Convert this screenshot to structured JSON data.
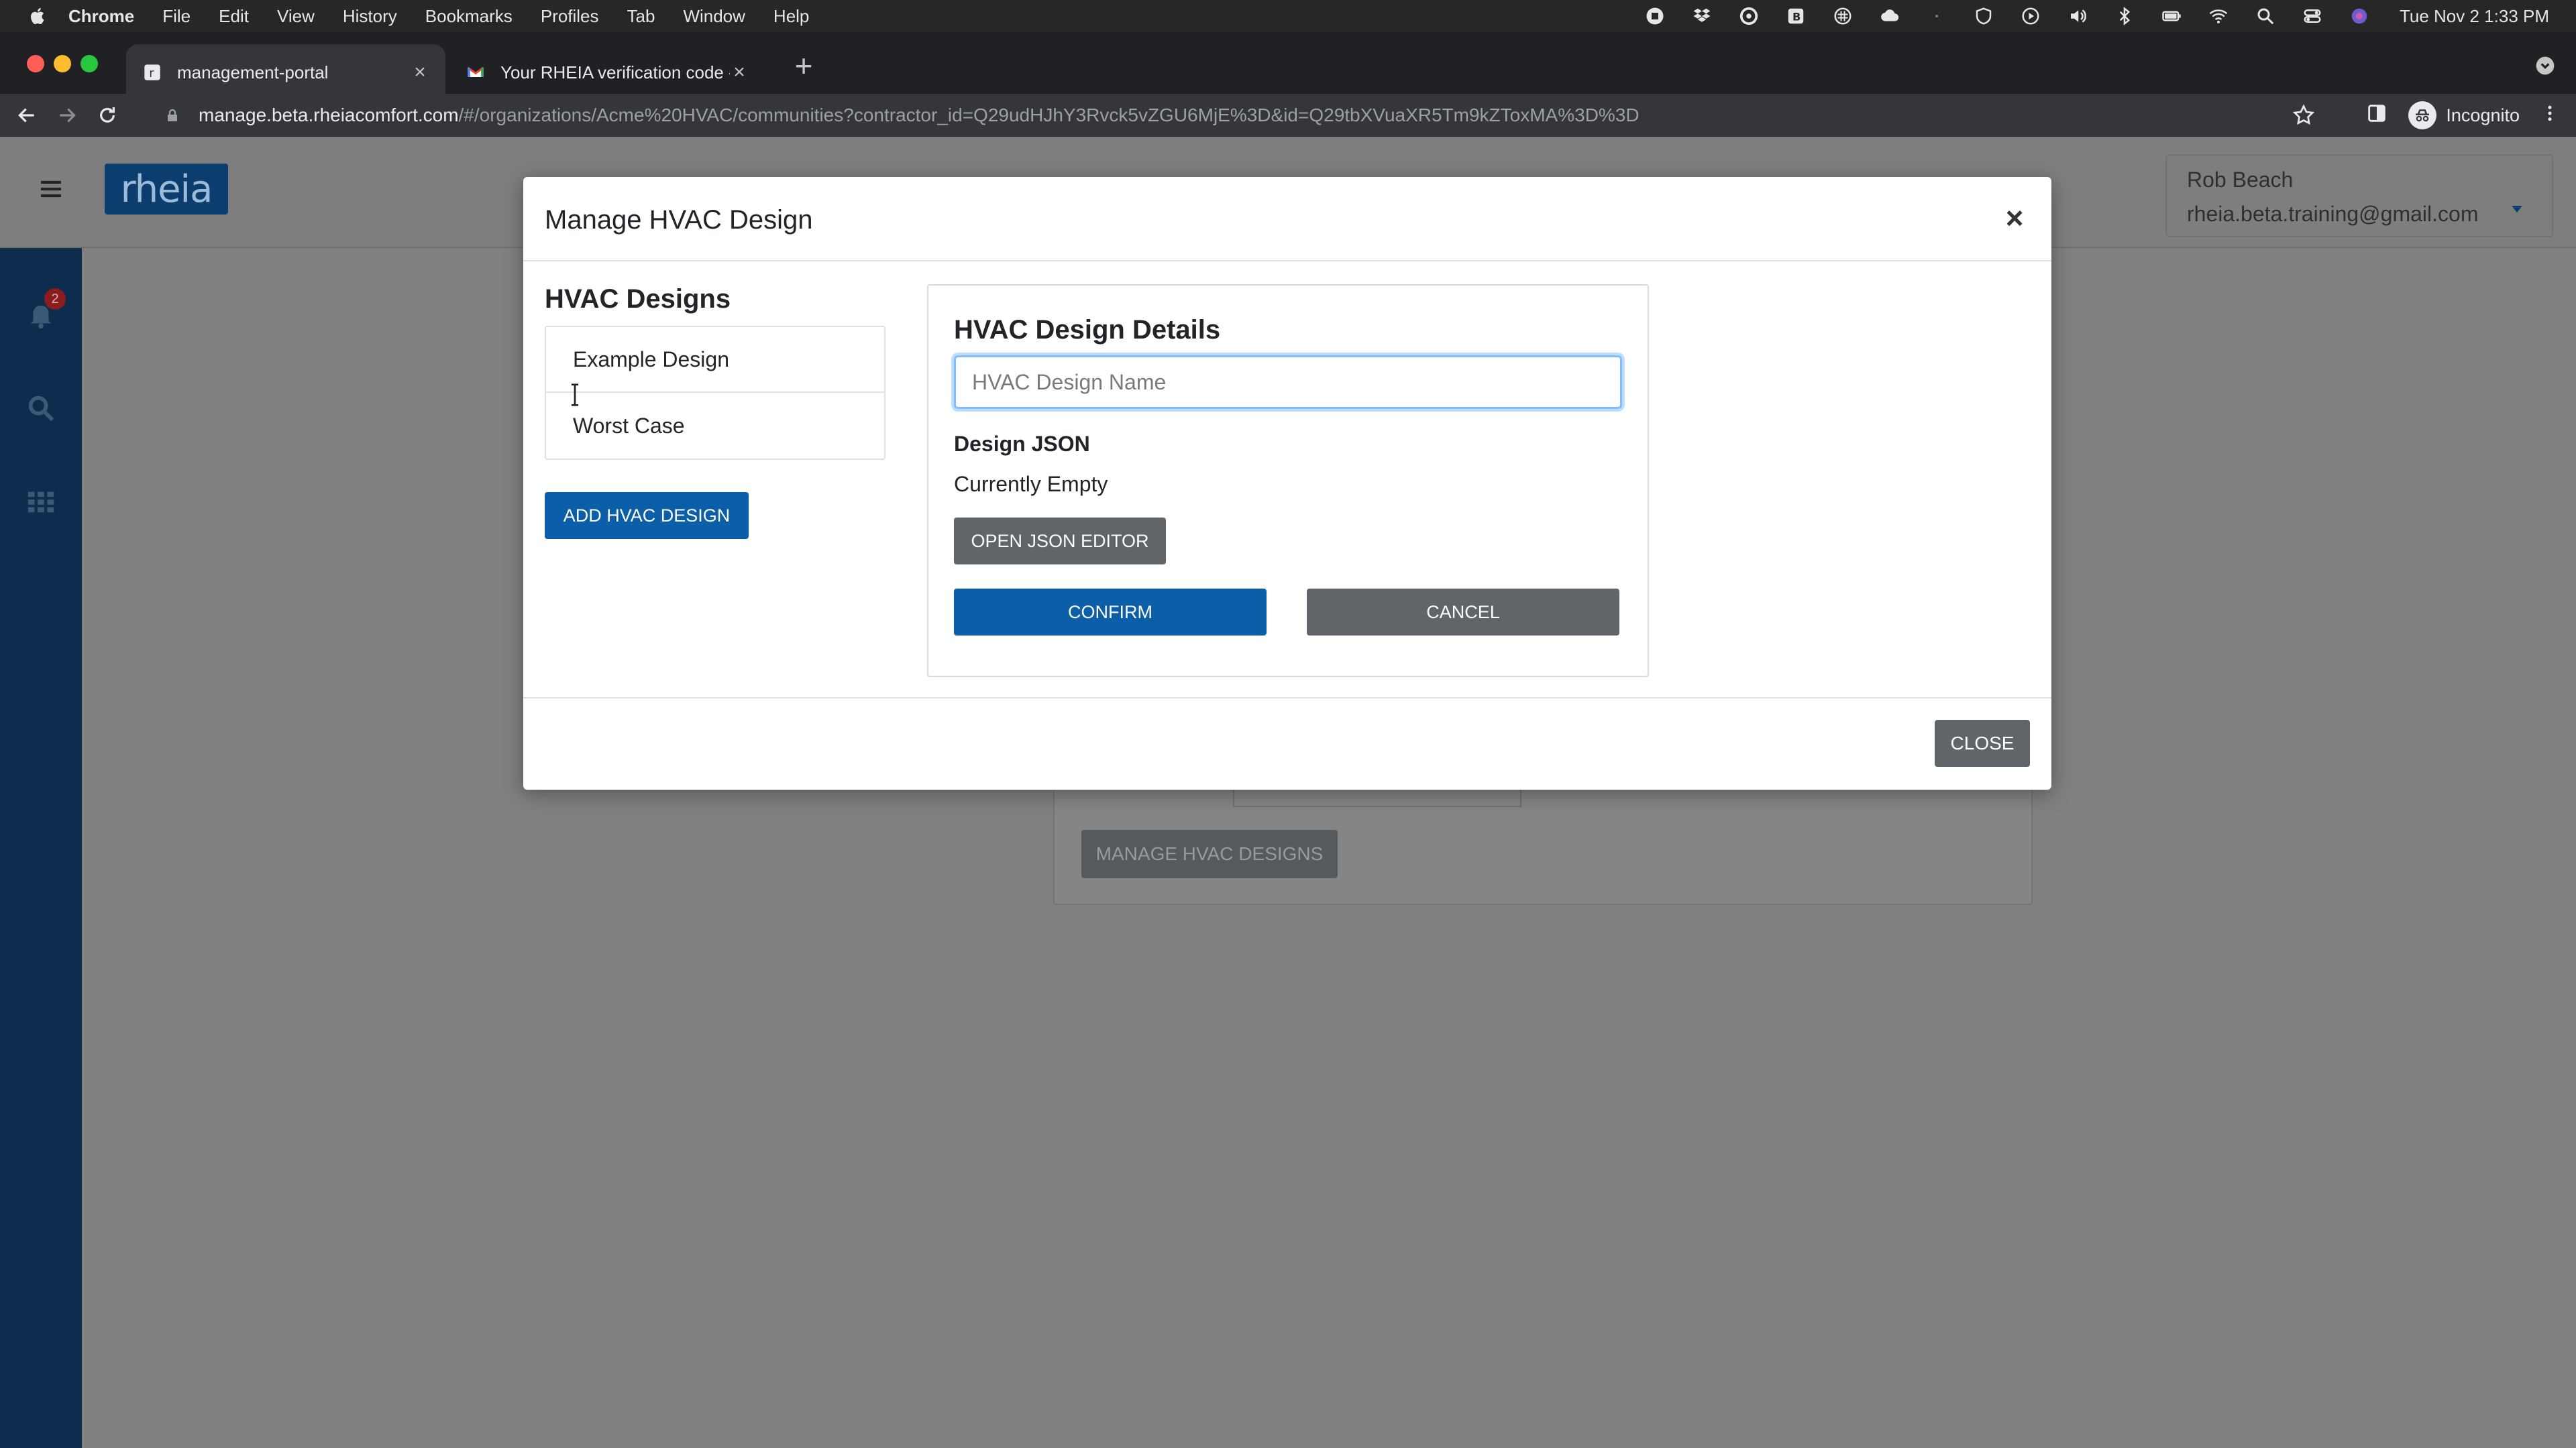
{
  "menubar": {
    "app": "Chrome",
    "items": [
      "File",
      "Edit",
      "View",
      "History",
      "Bookmarks",
      "Profiles",
      "Tab",
      "Window",
      "Help"
    ],
    "clock": "Tue Nov 2  1:33 PM"
  },
  "tabs": [
    {
      "title": "management-portal",
      "active": true
    },
    {
      "title": "Your RHEIA verification code -",
      "active": false
    }
  ],
  "browser": {
    "url_host": "manage.beta.rheiacomfort.com",
    "url_path": "/#/organizations/Acme%20HVAC/communities?contractor_id=Q29udHJhY3Rvck5vZGU6MjE%3D&id=Q29tbXVuaXR5Tm9kZToxMA%3D%3D",
    "profile_label": "Incognito"
  },
  "app": {
    "logo": "rheia",
    "notification_count": "2",
    "user": {
      "name": "Rob Beach",
      "email": "rheia.beta.training@gmail.com"
    },
    "background_button": "MANAGE HVAC DESIGNS"
  },
  "modal": {
    "title": "Manage HVAC Design",
    "designs_heading": "HVAC Designs",
    "designs": [
      "Example Design",
      "Worst Case"
    ],
    "add_button": "ADD HVAC DESIGN",
    "details": {
      "heading": "HVAC Design Details",
      "name_value": "",
      "name_placeholder": "HVAC Design Name",
      "json_label": "Design JSON",
      "json_status": "Currently Empty",
      "json_editor_button": "OPEN JSON EDITOR",
      "confirm_button": "CONFIRM",
      "cancel_button": "CANCEL"
    },
    "close_button": "CLOSE"
  },
  "colors": {
    "primary": "#0b5ea8",
    "secondary": "#5f6569",
    "sidebar": "#0c2d4d",
    "badge": "#8b1d1d"
  }
}
